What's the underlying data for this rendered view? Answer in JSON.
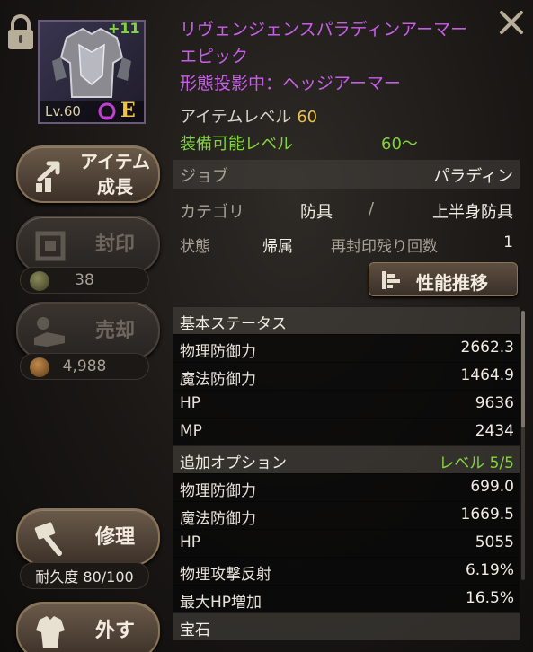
{
  "item": {
    "enhance": "+11",
    "level": "Lv.60",
    "grade": "E",
    "name": "リヴェンジェンスパラディンアーマー",
    "rarity": "エピック",
    "projection": "形態投影中：ヘッジアーマー",
    "item_level_label": "アイテムレベル",
    "item_level_value": "60",
    "equip_level_label": "装備可能レベル",
    "equip_level_value": "60～"
  },
  "details": {
    "job_label": "ジョブ",
    "job_value": "パラディン",
    "category_label": "カテゴリ",
    "category_main": "防具",
    "category_sep": "/",
    "category_sub": "上半身防具",
    "state_label": "状態",
    "state_value": "帰属",
    "reseal_label": "再封印残り回数",
    "reseal_value": "1"
  },
  "buttons": {
    "growth_line1": "アイテム",
    "growth_line2": "成長",
    "seal": "封印",
    "seal_cost": "38",
    "sell": "売却",
    "sell_price": "4,988",
    "repair": "修理",
    "durability": "耐久度 80/100",
    "unequip": "外す",
    "performance": "性能推移"
  },
  "basic_stats": {
    "title": "基本ステータス",
    "rows": [
      {
        "label": "物理防御力",
        "value": "2662.3"
      },
      {
        "label": "魔法防御力",
        "value": "1464.9"
      },
      {
        "label": "HP",
        "value": "9636"
      },
      {
        "label": "MP",
        "value": "2434"
      }
    ]
  },
  "extra_options": {
    "title": "追加オプション",
    "level": "レベル 5/5",
    "rows": [
      {
        "label": "物理防御力",
        "value": "699.0"
      },
      {
        "label": "魔法防御力",
        "value": "1669.5"
      },
      {
        "label": "HP",
        "value": "5055"
      },
      {
        "label": "物理攻撃反射",
        "value": "6.19%"
      },
      {
        "label": "最大HP増加",
        "value": "16.5%"
      }
    ]
  },
  "gem": {
    "title": "宝石"
  },
  "icons": {
    "lock": "lock-icon",
    "close": "close-icon",
    "growth": "growth-arrow-icon",
    "seal": "seal-icon",
    "sell": "sell-hand-icon",
    "repair": "hammer-icon",
    "unequip": "armor-icon",
    "performance": "bar-chart-icon"
  },
  "colors": {
    "epic": "#c85ee8",
    "green": "#7fd63a",
    "gold": "#f0c24a"
  }
}
